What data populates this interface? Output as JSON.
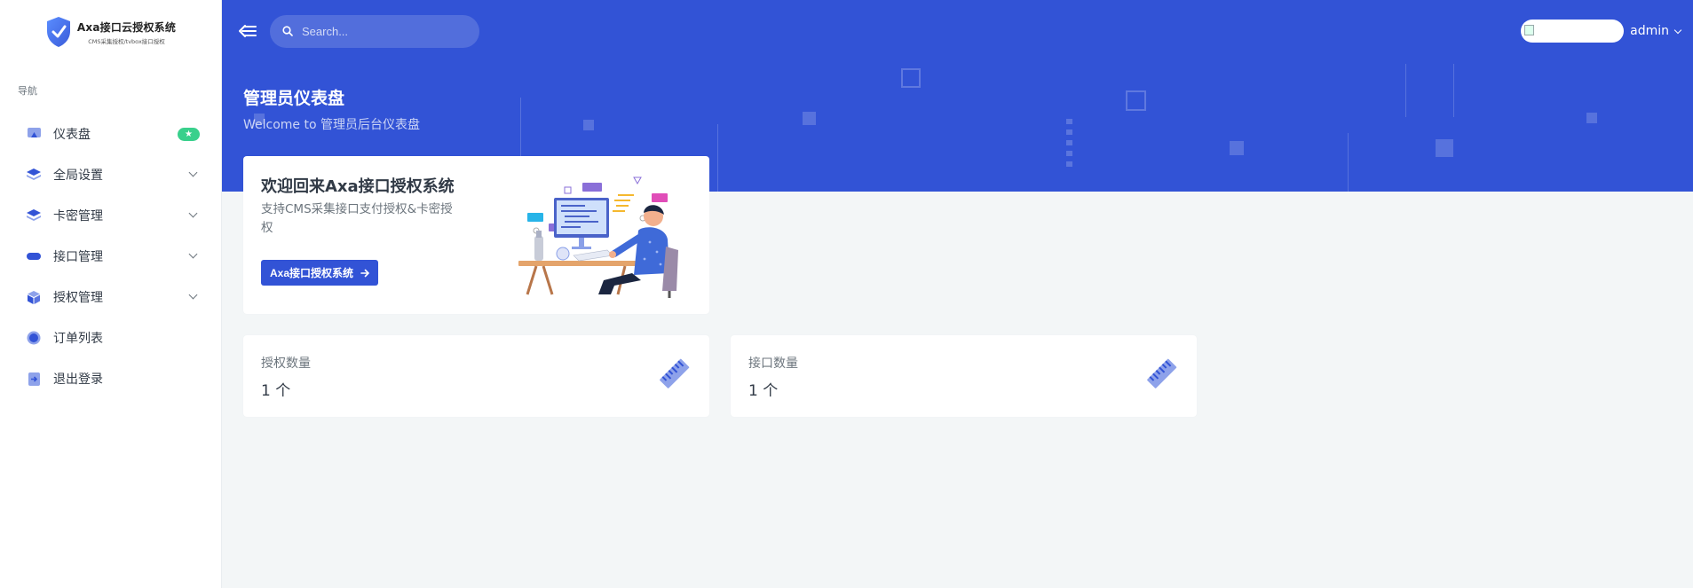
{
  "brand": {
    "title": "Axa接口云授权系统",
    "subtitle": "CMS采集授权/tvbox接口授权"
  },
  "sidebar": {
    "section_title": "导航",
    "items": [
      {
        "label": "仪表盘",
        "icon": "dashboard-icon",
        "badge": "★"
      },
      {
        "label": "全局设置",
        "icon": "layers-icon",
        "has_submenu": true
      },
      {
        "label": "卡密管理",
        "icon": "layers-icon",
        "has_submenu": true
      },
      {
        "label": "接口管理",
        "icon": "pill-icon",
        "has_submenu": true
      },
      {
        "label": "授权管理",
        "icon": "box-icon",
        "has_submenu": true
      },
      {
        "label": "订单列表",
        "icon": "circle-icon"
      },
      {
        "label": "退出登录",
        "icon": "logout-icon"
      }
    ]
  },
  "topbar": {
    "search_placeholder": "Search...",
    "username": "admin"
  },
  "page": {
    "title": "管理员仪表盘",
    "subtitle": "Welcome to 管理员后台仪表盘"
  },
  "welcome_card": {
    "title": "欢迎回来Axa接口授权系统",
    "description": "支持CMS采集接口支付授权&卡密授权",
    "button_label": "Axa接口授权系统"
  },
  "stats": [
    {
      "label": "授权数量",
      "value": "1 个",
      "icon": "ruler-icon"
    },
    {
      "label": "接口数量",
      "value": "1 个",
      "icon": "ruler-icon"
    }
  ],
  "colors": {
    "primary": "#3253d6",
    "badge": "#39d08c",
    "background": "#f3f6f7"
  }
}
